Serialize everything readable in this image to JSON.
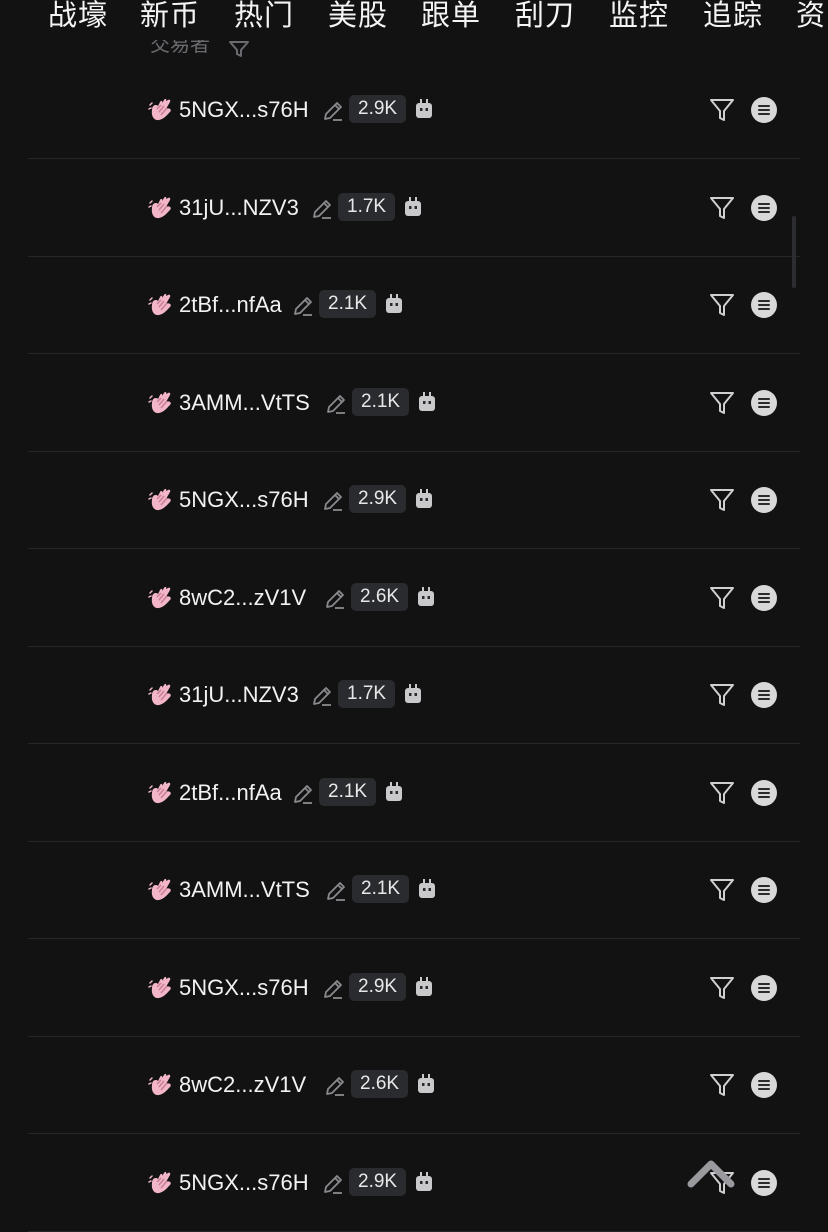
{
  "top_tabs": [
    "战壕",
    "新币",
    "热门",
    "美股",
    "跟单",
    "刮刀",
    "监控",
    "追踪",
    "资"
  ],
  "column_header": {
    "label": "交易者",
    "icon": "filter-icon"
  },
  "colors": {
    "background": "#121213",
    "avatar_pink": "#f3b6c8",
    "badge_bg": "#2a2b2e",
    "menu_circle": "#d8d8d8"
  },
  "rows": [
    {
      "address": "5NGX...s76H",
      "count": "2.9K"
    },
    {
      "address": "31jU...NZV3",
      "count": "1.7K"
    },
    {
      "address": "2tBf...nfAa",
      "count": "2.1K"
    },
    {
      "address": "3AMM...VtTS",
      "count": "2.1K"
    },
    {
      "address": "5NGX...s76H",
      "count": "2.9K"
    },
    {
      "address": "8wC2...zV1V",
      "count": "2.6K"
    },
    {
      "address": "31jU...NZV3",
      "count": "1.7K"
    },
    {
      "address": "2tBf...nfAa",
      "count": "2.1K"
    },
    {
      "address": "3AMM...VtTS",
      "count": "2.1K"
    },
    {
      "address": "5NGX...s76H",
      "count": "2.9K"
    },
    {
      "address": "8wC2...zV1V",
      "count": "2.6K"
    },
    {
      "address": "5NGX...s76H",
      "count": "2.9K"
    }
  ],
  "icons": {
    "avatar": "waving-hand-icon",
    "edit": "pencil-icon",
    "bot": "robot-icon",
    "filter": "filter-icon",
    "menu": "menu-circle-icon",
    "scroll_top": "chevron-up-icon"
  }
}
